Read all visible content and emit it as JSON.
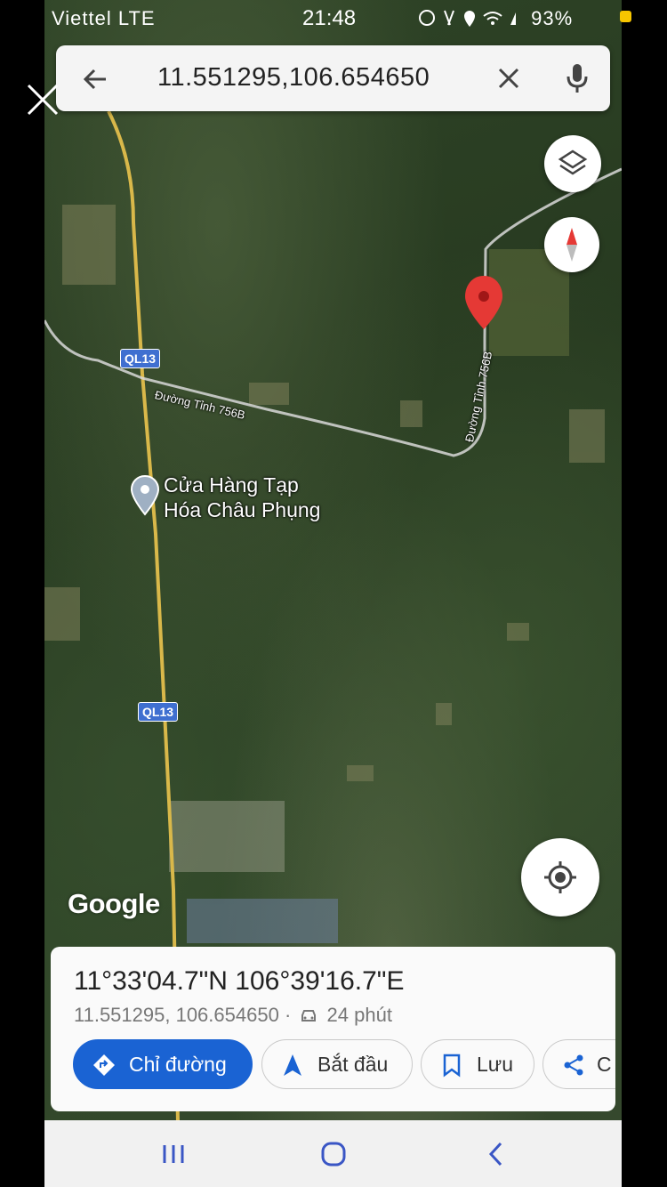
{
  "status_bar": {
    "carrier": "Viettel LTE",
    "time": "21:48",
    "battery": "93%"
  },
  "search": {
    "query": "11.551295,106.654650"
  },
  "map": {
    "roads": {
      "ql13_top": "QL13",
      "ql13_bottom": "QL13",
      "provincial_west": "Đường Tỉnh 756B",
      "provincial_east": "Đường Tỉnh 756B"
    },
    "poi": {
      "line1": "Cửa Hàng Tạp",
      "line2": "Hóa Châu Phụng"
    },
    "attribution": "Google",
    "pin_color": "#e53935"
  },
  "place_card": {
    "dms": "11°33'04.7\"N 106°39'16.7\"E",
    "decimal": "11.551295, 106.654650",
    "separator": "·",
    "drive_time": "24 phút",
    "buttons": {
      "directions": "Chỉ đường",
      "start": "Bắt đầu",
      "save": "Lưu",
      "share": "C"
    }
  },
  "colors": {
    "accent": "#1a63d3",
    "shield": "#3f6fd0"
  }
}
